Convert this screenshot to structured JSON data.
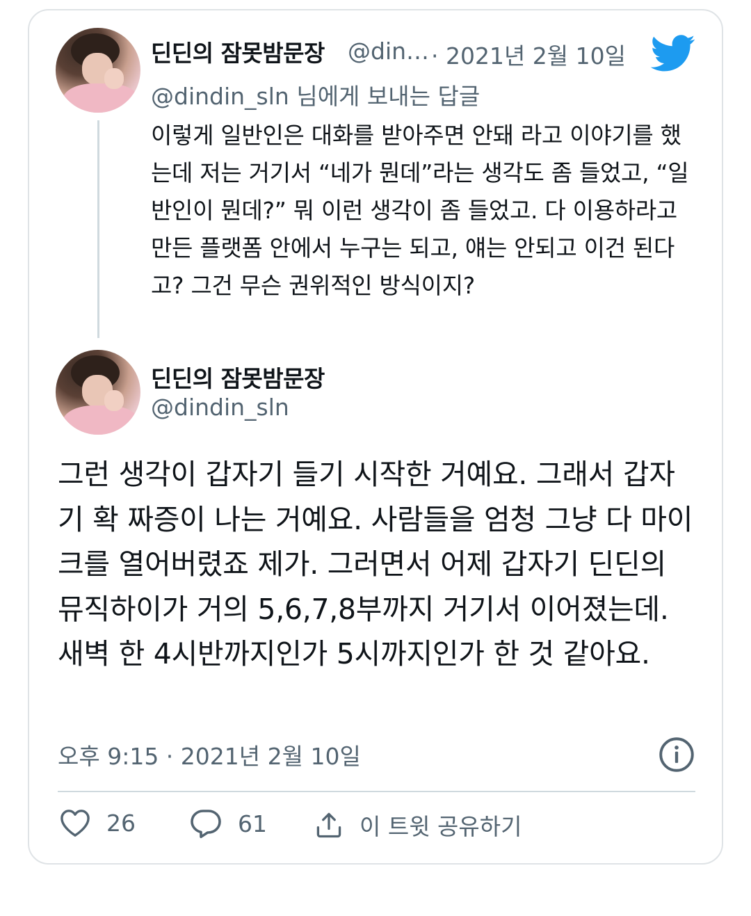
{
  "reply_tweet": {
    "display_name": "딘딘의 잠못밤문장",
    "handle": "@din…",
    "date": "· 2021년 2월 10일",
    "reply_to": "@dindin_sln 님에게 보내는 답글",
    "text": "이렇게 일반인은 대화를 받아주면 안돼 라고 이야기를 했는데 저는 거기서 “네가 뭔데”라는 생각도 좀 들었고, “일반인이 뭔데?” 뭐 이런 생각이 좀 들었고. 다 이용하라고 만든 플랫폼 안에서 누구는 되고, 얘는 안되고 이건 된다고? 그건 무슨 권위적인 방식이지?"
  },
  "main_tweet": {
    "display_name": "딘딘의 잠못밤문장",
    "handle": "@dindin_sln",
    "text": "그런 생각이 갑자기 들기 시작한 거예요. 그래서 갑자기 확 짜증이 나는 거예요. 사람들을 엄청 그냥 다 마이크를 열어버렸죠 제가. 그러면서 어제 갑자기 딘딘의 뮤직하이가 거의 5,6,7,8부까지 거기서 이어졌는데. 새벽 한 4시반까지인가 5시까지인가 한 것 같아요.",
    "timestamp": "오후 9:15 · 2021년 2월 10일"
  },
  "actions": {
    "likes": "26",
    "replies": "61",
    "share_label": "이 트윗 공유하기"
  },
  "icons": {
    "brand": "twitter-bird-icon",
    "info": "info-icon",
    "like": "heart-icon",
    "reply": "comment-icon",
    "share": "share-icon"
  },
  "colors": {
    "twitter_blue": "#1d9bf0",
    "text": "#0f1419",
    "muted": "#536471",
    "border": "#dfe3e6"
  }
}
